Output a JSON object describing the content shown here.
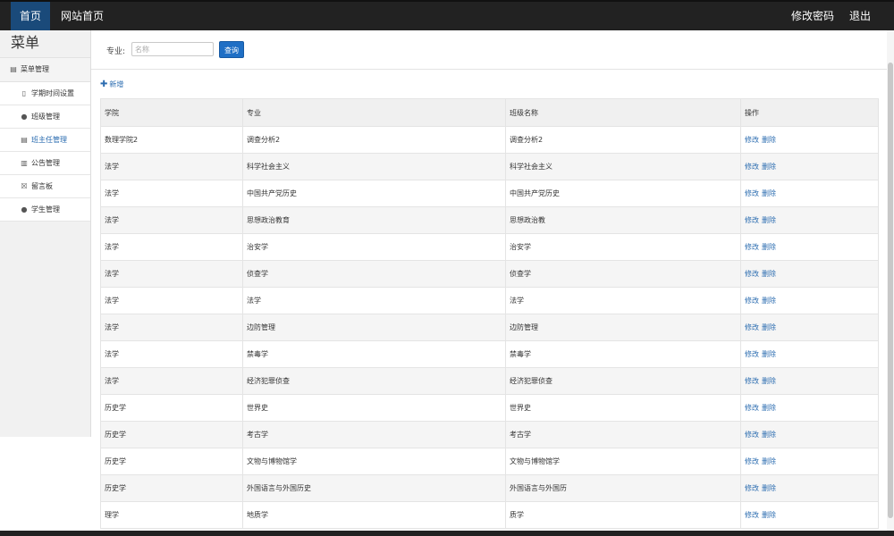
{
  "topbar": {
    "home": "首页",
    "site_home": "网站首页",
    "change_password": "修改密码",
    "logout": "退出"
  },
  "sidebar": {
    "title": "菜单",
    "group": "菜单管理",
    "items": [
      {
        "label": "学期时间设置",
        "icon": "file-icon"
      },
      {
        "label": "班级管理",
        "icon": "comment-icon"
      },
      {
        "label": "班主任管理",
        "icon": "list-icon"
      },
      {
        "label": "公告管理",
        "icon": "bars-icon"
      },
      {
        "label": "留言板",
        "icon": "message-icon"
      },
      {
        "label": "学生管理",
        "icon": "comment-icon"
      }
    ]
  },
  "search": {
    "label": "专业:",
    "placeholder": "名称",
    "button": "查询"
  },
  "add_label": "新增",
  "table": {
    "headers": [
      "学院",
      "专业",
      "班级名称",
      "操作"
    ],
    "edit_label": "修改",
    "delete_label": "删除",
    "rows": [
      [
        "数理学院2",
        "调查分析2",
        "调查分析2"
      ],
      [
        "法学",
        "科学社会主义",
        "科学社会主义"
      ],
      [
        "法学",
        "中国共产党历史",
        "中国共产党历史"
      ],
      [
        "法学",
        "思想政治教育",
        "思想政治教"
      ],
      [
        "法学",
        "治安学",
        "治安学"
      ],
      [
        "法学",
        "侦查学",
        "侦查学"
      ],
      [
        "法学",
        "法学",
        "法学"
      ],
      [
        "法学",
        "边防管理",
        "边防管理"
      ],
      [
        "法学",
        "禁毒学",
        "禁毒学"
      ],
      [
        "法学",
        "经济犯罪侦查",
        "经济犯罪侦查"
      ],
      [
        "历史学",
        "世界史",
        "世界史"
      ],
      [
        "历史学",
        "考古学",
        "考古学"
      ],
      [
        "历史学",
        "文物与博物馆学",
        "文物与博物馆学"
      ],
      [
        "历史学",
        "外国语言与外国历史",
        "外国语言与外国历"
      ],
      [
        "理学",
        "地质学",
        "质学"
      ]
    ]
  },
  "colors": {
    "topbar_bg": "#222222",
    "active_nav": "#1a4a7a",
    "link": "#2b6cb0",
    "primary_button": "#1f6fc5"
  }
}
